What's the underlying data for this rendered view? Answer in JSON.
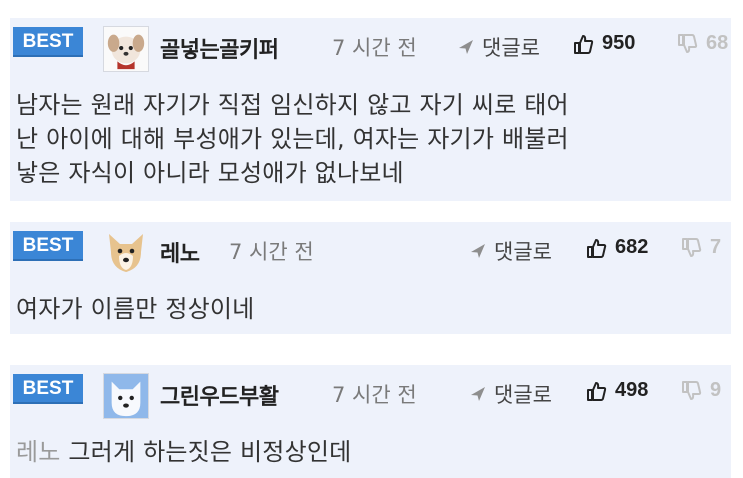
{
  "comments": [
    {
      "badge": "BEST",
      "nickname": "골넣는골키퍼",
      "time": "7 시간 전",
      "reply_label": "댓글로",
      "upvotes": "950",
      "downvotes": "68",
      "avatar_icon": "puppy-avatar-icon",
      "lines": [
        "남자는 원래 자기가 직접 임신하지 않고 자기 씨로 태어",
        "난 아이에 대해 부성애가 있는데, 여자는 자기가 배불러",
        "낳은 자식이 아니라 모성애가 없나보네"
      ]
    },
    {
      "badge": "BEST",
      "nickname": "레노",
      "time": "7 시간 전",
      "reply_label": "댓글로",
      "upvotes": "682",
      "downvotes": "7",
      "avatar_icon": "dog-avatar-icon",
      "lines": [
        "여자가 이름만 정상이네"
      ]
    },
    {
      "badge": "BEST",
      "nickname": "그린우드부활",
      "time": "7 시간 전",
      "reply_label": "댓글로",
      "upvotes": "498",
      "downvotes": "9",
      "avatar_icon": "white-dog-avatar-icon",
      "mention": "레노",
      "text": "그러게 하는짓은 비정상인데"
    }
  ],
  "colors": {
    "badge_bg": "#3b86d6",
    "card_bg": "#eef2fb",
    "downvote": "#c2c2c2"
  }
}
